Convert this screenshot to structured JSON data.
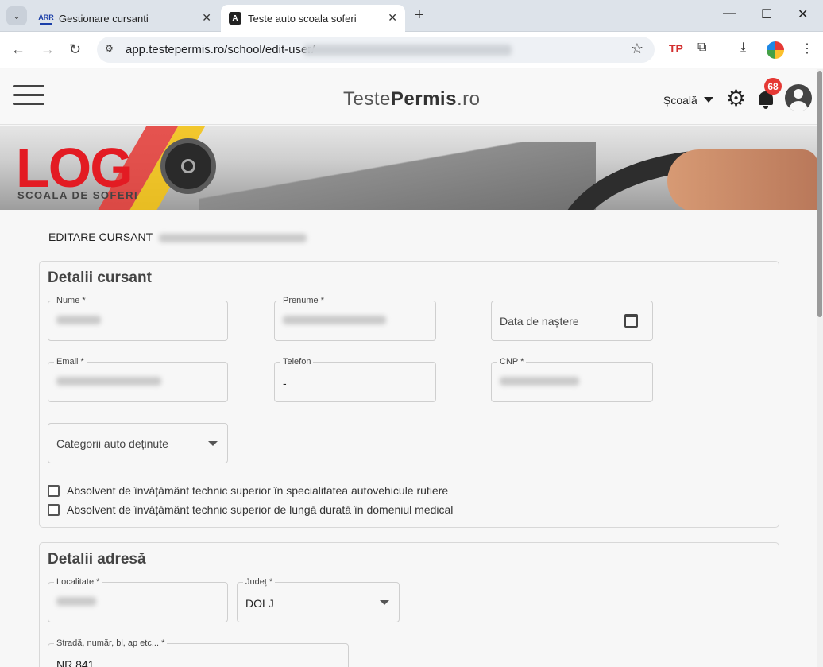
{
  "browser": {
    "tabs": [
      {
        "title": "Gestionare cursanti",
        "favicon": "ARR"
      },
      {
        "title": "Teste auto scoala soferi",
        "favicon": "A"
      }
    ],
    "new_tab": "+",
    "url": "app.testepermis.ro/school/edit-user/"
  },
  "app": {
    "brand_light": "Teste",
    "brand_bold": "Permis",
    "brand_suffix": ".ro",
    "menu_label": "Școală",
    "notifications": "68"
  },
  "banner": {
    "logo": "LOG",
    "logo_sub": "SCOALA DE SOFERI"
  },
  "page": {
    "title": "EDITARE CURSANT"
  },
  "student": {
    "section_title": "Detalii cursant",
    "fields": {
      "nume": {
        "label": "Nume *"
      },
      "prenume": {
        "label": "Prenume *"
      },
      "data_nasterii": {
        "placeholder": "Data de naștere"
      },
      "email": {
        "label": "Email *"
      },
      "telefon": {
        "label": "Telefon",
        "value": "-"
      },
      "cnp": {
        "label": "CNP *"
      },
      "categorii": {
        "placeholder": "Categorii auto deținute"
      }
    },
    "checkboxes": [
      {
        "label": "Absolvent de învățământ technic superior în specialitatea autovehicule rutiere",
        "checked": false
      },
      {
        "label": "Absolvent de învățământ technic superior de lungă durată în domeniul medical",
        "checked": false
      }
    ]
  },
  "address": {
    "section_title": "Detalii adresă",
    "fields": {
      "localitate": {
        "label": "Localitate *"
      },
      "judet": {
        "label": "Județ *",
        "value": "DOLJ"
      },
      "strada": {
        "label": "Stradă, număr, bl, ap etc... *",
        "value": "NR.841"
      }
    }
  }
}
